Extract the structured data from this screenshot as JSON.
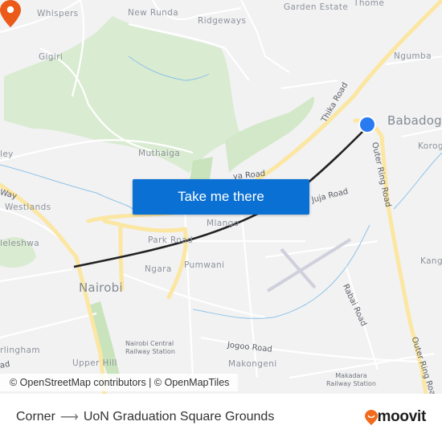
{
  "map": {
    "places": {
      "whispers": "Whispers",
      "new_runda": "New Runda",
      "ridgeways": "Ridgeways",
      "garden_estate": "Garden Estate",
      "thome": "Thome",
      "gigiri": "Gigiri",
      "ngumba": "Ngumba",
      "babadogo": "Babadogo",
      "korogocho": "Korog",
      "muthaiga": "Muthaiga",
      "valley": "ley",
      "westlands": "Westlands",
      "kileleshwa": "leleshwa",
      "mlango": "Mlango",
      "park_road": "Park Road",
      "ngara": "Ngara",
      "pumwani": "Pumwani",
      "nairobi": "Nairobi",
      "kangundo": "Kang",
      "kilimani": "rlingham",
      "upper_hill": "Upper Hill",
      "makongeni": "Makongeni"
    },
    "roads": {
      "thika_road": "Thika Road",
      "outer_ring_road_north": "Outer Ring Road",
      "outer_ring_road_south": "Outer Ring Road",
      "juja_road": "Juja Road",
      "mathare_road": "ya Road",
      "rabai_road": "Rabai Road",
      "jogoo_road": "Jogoo Road",
      "waiyaki_way": "Way",
      "ngong_road": "ad"
    },
    "stations": {
      "nairobi_central": "Nairobi Central\nRailway Station",
      "makadara": "Makadara\nRailway Station"
    },
    "colors": {
      "background": "#f2f2f3",
      "park": "#d9ebd1",
      "major_road": "#fbe6a2",
      "water": "#8ec3e6",
      "route_line": "#222222",
      "origin": "#2a7bf2",
      "destination": "#ec5a1a"
    },
    "origin_marker": "origin-dot",
    "destination_marker": "destination-pin"
  },
  "cta": {
    "label": "Take me there"
  },
  "attribution": "© OpenStreetMap contributors | © OpenMapTiles",
  "footer": {
    "origin": "Corner",
    "arrow": "⟶",
    "destination": "UoN Graduation Square Grounds",
    "brand": "moovit",
    "brand_color": "#f26a1b"
  }
}
